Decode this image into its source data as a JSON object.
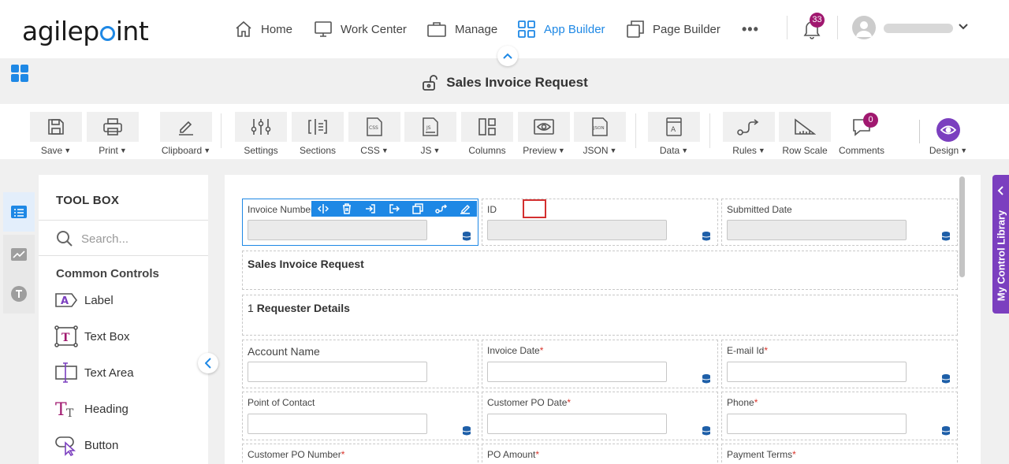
{
  "brand": {
    "logo_left": "agilep",
    "logo_right": "int"
  },
  "nav": [
    {
      "label": "Home",
      "icon": "home-icon"
    },
    {
      "label": "Work Center",
      "icon": "monitor-icon"
    },
    {
      "label": "Manage",
      "icon": "briefcase-icon"
    },
    {
      "label": "App Builder",
      "icon": "grid-icon",
      "active": true
    },
    {
      "label": "Page Builder",
      "icon": "copy-icon"
    }
  ],
  "nav_more": "•••",
  "notifications": {
    "count": "33"
  },
  "form": {
    "title": "Sales Invoice Request"
  },
  "ribbon": [
    {
      "label": "Save",
      "caret": true,
      "icon": "save-icon"
    },
    {
      "label": "Print",
      "caret": true,
      "icon": "print-icon"
    },
    {
      "label": "Clipboard",
      "caret": true,
      "icon": "pencil-icon"
    },
    {
      "label": "Settings",
      "caret": false,
      "icon": "sliders-icon"
    },
    {
      "label": "Sections",
      "caret": false,
      "icon": "sections-icon"
    },
    {
      "label": "CSS",
      "caret": true,
      "icon": "css-file-icon"
    },
    {
      "label": "JS",
      "caret": true,
      "icon": "js-file-icon"
    },
    {
      "label": "Columns",
      "caret": false,
      "icon": "columns-icon"
    },
    {
      "label": "Preview",
      "caret": true,
      "icon": "eye-icon"
    },
    {
      "label": "JSON",
      "caret": true,
      "icon": "json-file-icon"
    },
    {
      "label": "Data",
      "caret": true,
      "icon": "data-icon"
    },
    {
      "label": "Rules",
      "caret": true,
      "icon": "rules-icon"
    },
    {
      "label": "Row Scale",
      "caret": false,
      "icon": "row-scale-icon"
    },
    {
      "label": "Comments",
      "caret": false,
      "icon": "comment-icon"
    },
    {
      "label": "Design",
      "caret": true,
      "icon": "design-eye-icon"
    }
  ],
  "comments_count": "0",
  "toolbox": {
    "title": "TOOL BOX",
    "search_placeholder": "Search...",
    "section": "Common Controls",
    "items": [
      {
        "label": "Label",
        "icon": "label-control-icon"
      },
      {
        "label": "Text Box",
        "icon": "textbox-control-icon"
      },
      {
        "label": "Text Area",
        "icon": "textarea-control-icon"
      },
      {
        "label": "Heading",
        "icon": "heading-control-icon"
      },
      {
        "label": "Button",
        "icon": "button-control-icon"
      }
    ]
  },
  "canvas": {
    "row1": [
      {
        "label": "Invoice Number"
      },
      {
        "label": "ID"
      },
      {
        "label": "Submitted Date"
      }
    ],
    "section_title": "Sales Invoice Request",
    "section1": {
      "number": "1",
      "title": "Requester Details"
    },
    "row2": [
      {
        "label": "Account Name",
        "required": false
      },
      {
        "label": "Invoice Date",
        "required": true
      },
      {
        "label": "E-mail Id",
        "required": true
      }
    ],
    "row3": [
      {
        "label": "Point of Contact",
        "required": false
      },
      {
        "label": "Customer PO Date",
        "required": true
      },
      {
        "label": "Phone",
        "required": true
      }
    ],
    "row4": [
      {
        "label": "Customer PO Number",
        "required": true
      },
      {
        "label": "PO Amount",
        "required": true
      },
      {
        "label": "Payment Terms",
        "required": true
      }
    ],
    "required_mark": "*"
  },
  "control_toolbar": [
    "split-icon",
    "delete-icon",
    "move-in-icon",
    "move-out-icon",
    "duplicate-icon",
    "rules-link-icon",
    "edit-icon"
  ],
  "control_library": {
    "label": "My Control Library"
  },
  "colors": {
    "accent": "#1e88e5",
    "purple": "#7b3fbf",
    "badge": "#a0186f",
    "required": "#d9342b",
    "highlight": "#d32f2f"
  }
}
